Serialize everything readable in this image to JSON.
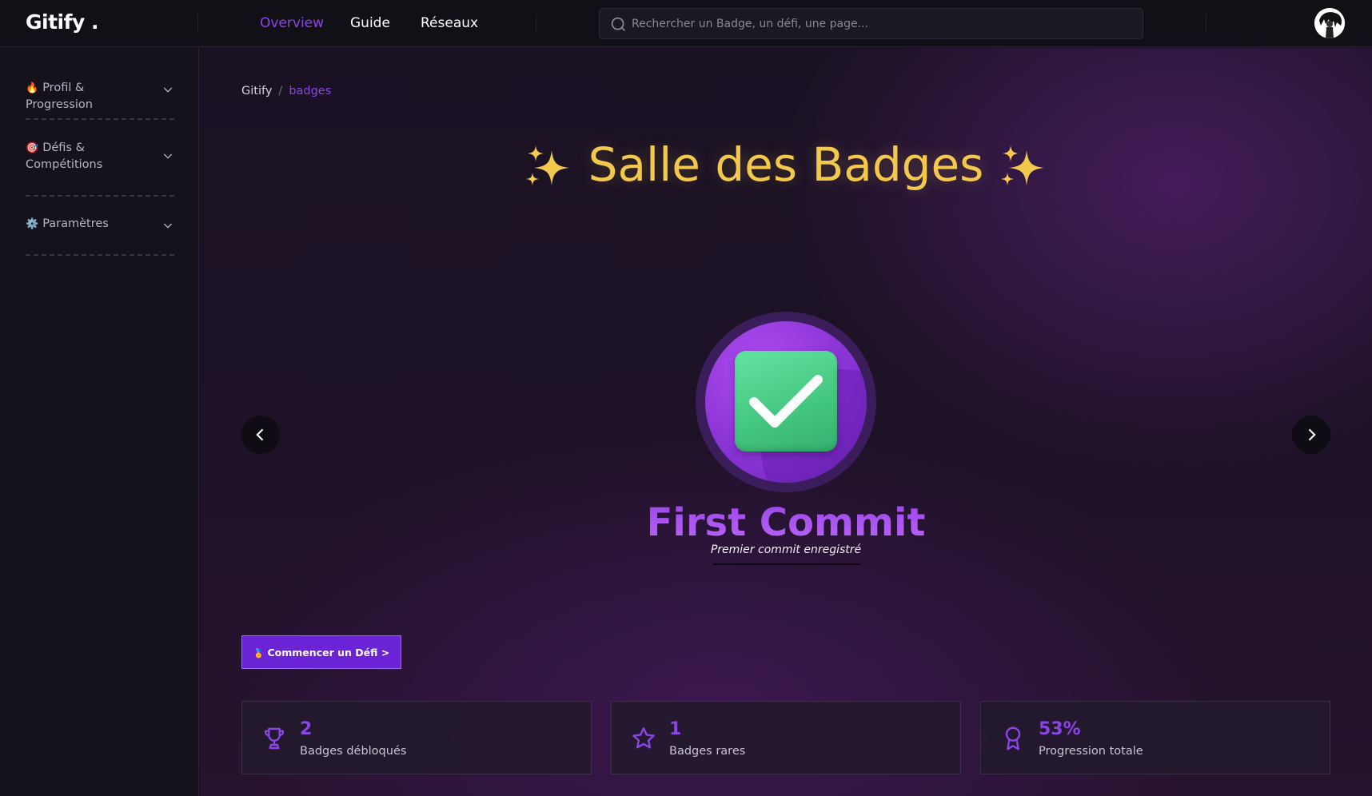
{
  "header": {
    "logo": "Gitify .",
    "nav": [
      {
        "label": "Overview",
        "active": true
      },
      {
        "label": "Guide",
        "active": false
      },
      {
        "label": "Réseaux",
        "active": false
      }
    ],
    "search": {
      "placeholder": "Rechercher un Badge, un défi, une page...",
      "value": ""
    },
    "colors": {
      "accent": "#8b45e6",
      "background": "#121017"
    }
  },
  "sidebar": {
    "items": [
      {
        "emoji": "🔥",
        "label": "Profil & Progression",
        "icon": "flame-icon"
      },
      {
        "emoji": "🎯",
        "label": "Défis & Compétitions",
        "icon": "target-icon"
      },
      {
        "emoji": "⚙️",
        "label": "Paramètres",
        "icon": "gear-icon"
      }
    ]
  },
  "breadcrumb": {
    "root": "Gitify",
    "separator": "/",
    "current": "badges"
  },
  "hero": {
    "title": "Salle des Badges",
    "sparkle_icon": "sparkles-icon",
    "title_color": "#f2c94c"
  },
  "badge": {
    "name": "First Commit",
    "description": "Premier commit enregistré",
    "icon": "check-box-icon",
    "colors": {
      "circle": "#8a34d6",
      "check": "#43c67f"
    }
  },
  "cta": {
    "emoji": "🏅",
    "label": "Commencer un Défi >"
  },
  "stats": [
    {
      "icon": "trophy-icon",
      "value": "2",
      "label": "Badges débloqués"
    },
    {
      "icon": "star-icon",
      "value": "1",
      "label": "Badges rares"
    },
    {
      "icon": "award-ribbon-icon",
      "value": "53%",
      "label": "Progression totale"
    }
  ]
}
